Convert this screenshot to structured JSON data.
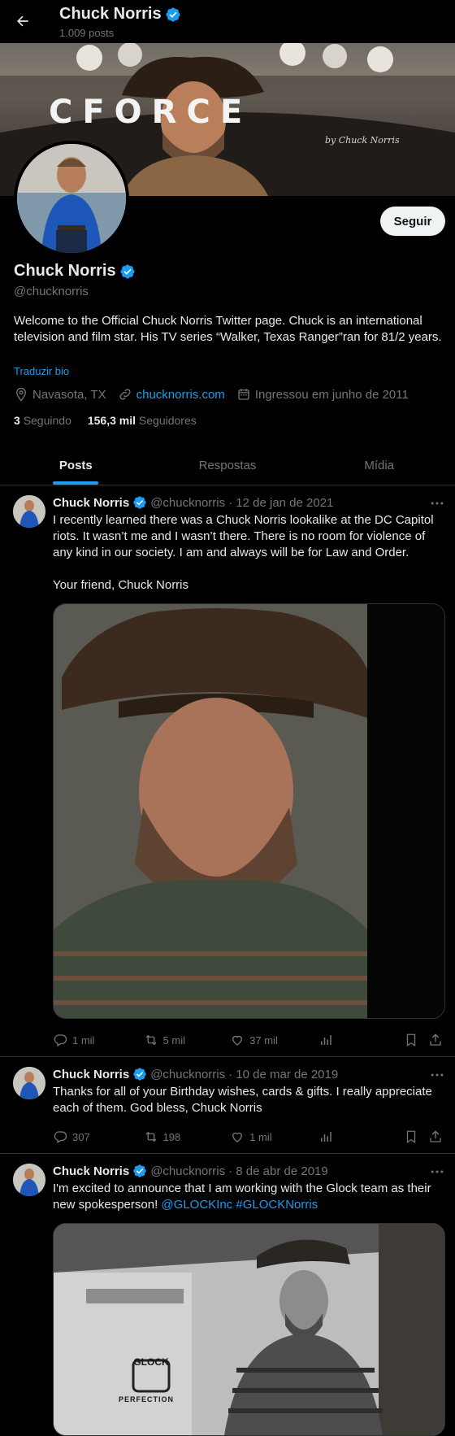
{
  "header": {
    "name": "Chuck Norris",
    "posts_count": "1.009 posts"
  },
  "banner": {
    "logo_text": "CFORCE",
    "signature": "by Chuck Norris"
  },
  "profile": {
    "name": "Chuck Norris",
    "handle": "@chucknorris",
    "follow_label": "Seguir",
    "bio": "Welcome to the Official Chuck Norris Twitter page. Chuck is an international television and film star. His TV series “Walker, Texas Ranger”ran for 81/2 years.",
    "translate_label": "Traduzir bio",
    "location": "Navasota, TX",
    "website": "chucknorris.com",
    "joined": "Ingressou em junho de 2011",
    "following_count": "3",
    "following_label": "Seguindo",
    "followers_count": "156,3 mil",
    "followers_label": "Seguidores"
  },
  "tabs": [
    {
      "label": "Posts"
    },
    {
      "label": "Respostas"
    },
    {
      "label": "Mídia"
    }
  ],
  "tweets": [
    {
      "name": "Chuck Norris",
      "handle": "@chucknorris",
      "date": "· 12 de jan de 2021",
      "text_line1": "I recently learned there was a Chuck Norris lookalike at the DC Capitol riots. It wasn’t me and I wasn’t there. There is no room for violence of any kind in our society. I am and always will be for Law and Order.",
      "text_line2": "Your friend, Chuck Norris",
      "replies": "1 mil",
      "reposts": "5 mil",
      "likes": "37 mil"
    },
    {
      "name": "Chuck Norris",
      "handle": "@chucknorris",
      "date": "· 10 de mar de 2019",
      "text": "Thanks for all of your Birthday wishes, cards & gifts. I really appreciate each of them. God bless, Chuck Norris",
      "replies": "307",
      "reposts": "198",
      "likes": "1 mil"
    },
    {
      "name": "Chuck Norris",
      "handle": "@chucknorris",
      "date": "· 8 de abr de 2019",
      "text": "I'm excited to announce that I am working with the Glock team as their new spokesperson!",
      "mention": "@GLOCKInc",
      "hashtag": "#GLOCKNorris",
      "media_logo": "GLOCK",
      "media_tagline": "PERFECTION"
    }
  ],
  "colors": {
    "accent": "#1d9bf0",
    "background": "#000000",
    "text": "#e7e9ea",
    "muted": "#71767b",
    "border": "#2f3336"
  },
  "icons": [
    "back-arrow-icon",
    "verified-badge-icon",
    "location-icon",
    "link-icon",
    "calendar-icon",
    "more-icon",
    "reply-icon",
    "repost-icon",
    "like-icon",
    "views-icon",
    "bookmark-icon",
    "share-icon"
  ]
}
